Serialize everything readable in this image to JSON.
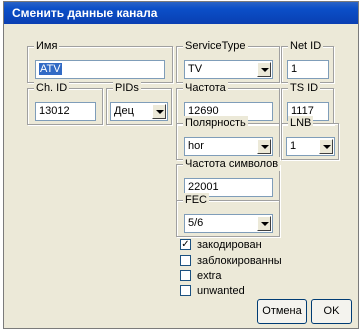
{
  "dialog": {
    "title": "Сменить данные канала"
  },
  "fields": {
    "name": {
      "label": "Имя",
      "value": "ATV"
    },
    "service_type": {
      "label": "ServiceType",
      "value": "TV"
    },
    "net_id": {
      "label": "Net ID",
      "value": "1"
    },
    "ch_id": {
      "label": "Ch. ID",
      "value": "13012"
    },
    "pids": {
      "label": "PIDs",
      "value": "Дец"
    },
    "frequency": {
      "label": "Частота",
      "value": "12690"
    },
    "ts_id": {
      "label": "TS ID",
      "value": "1117"
    },
    "polarity": {
      "label": "Полярность",
      "value": "hor"
    },
    "lnb": {
      "label": "LNB",
      "value": "1"
    },
    "symbol_rate": {
      "label": "Частота символов",
      "value": "22001"
    },
    "fec": {
      "label": "FEC",
      "value": "5/6"
    }
  },
  "checkboxes": [
    {
      "label": "закодирован",
      "checked": true,
      "mark": "✓"
    },
    {
      "label": "заблокированны",
      "checked": false,
      "mark": ""
    },
    {
      "label": "extra",
      "checked": false,
      "mark": ""
    },
    {
      "label": "unwanted",
      "checked": false,
      "mark": ""
    }
  ],
  "buttons": {
    "cancel": "Отмена",
    "ok": "OK"
  }
}
